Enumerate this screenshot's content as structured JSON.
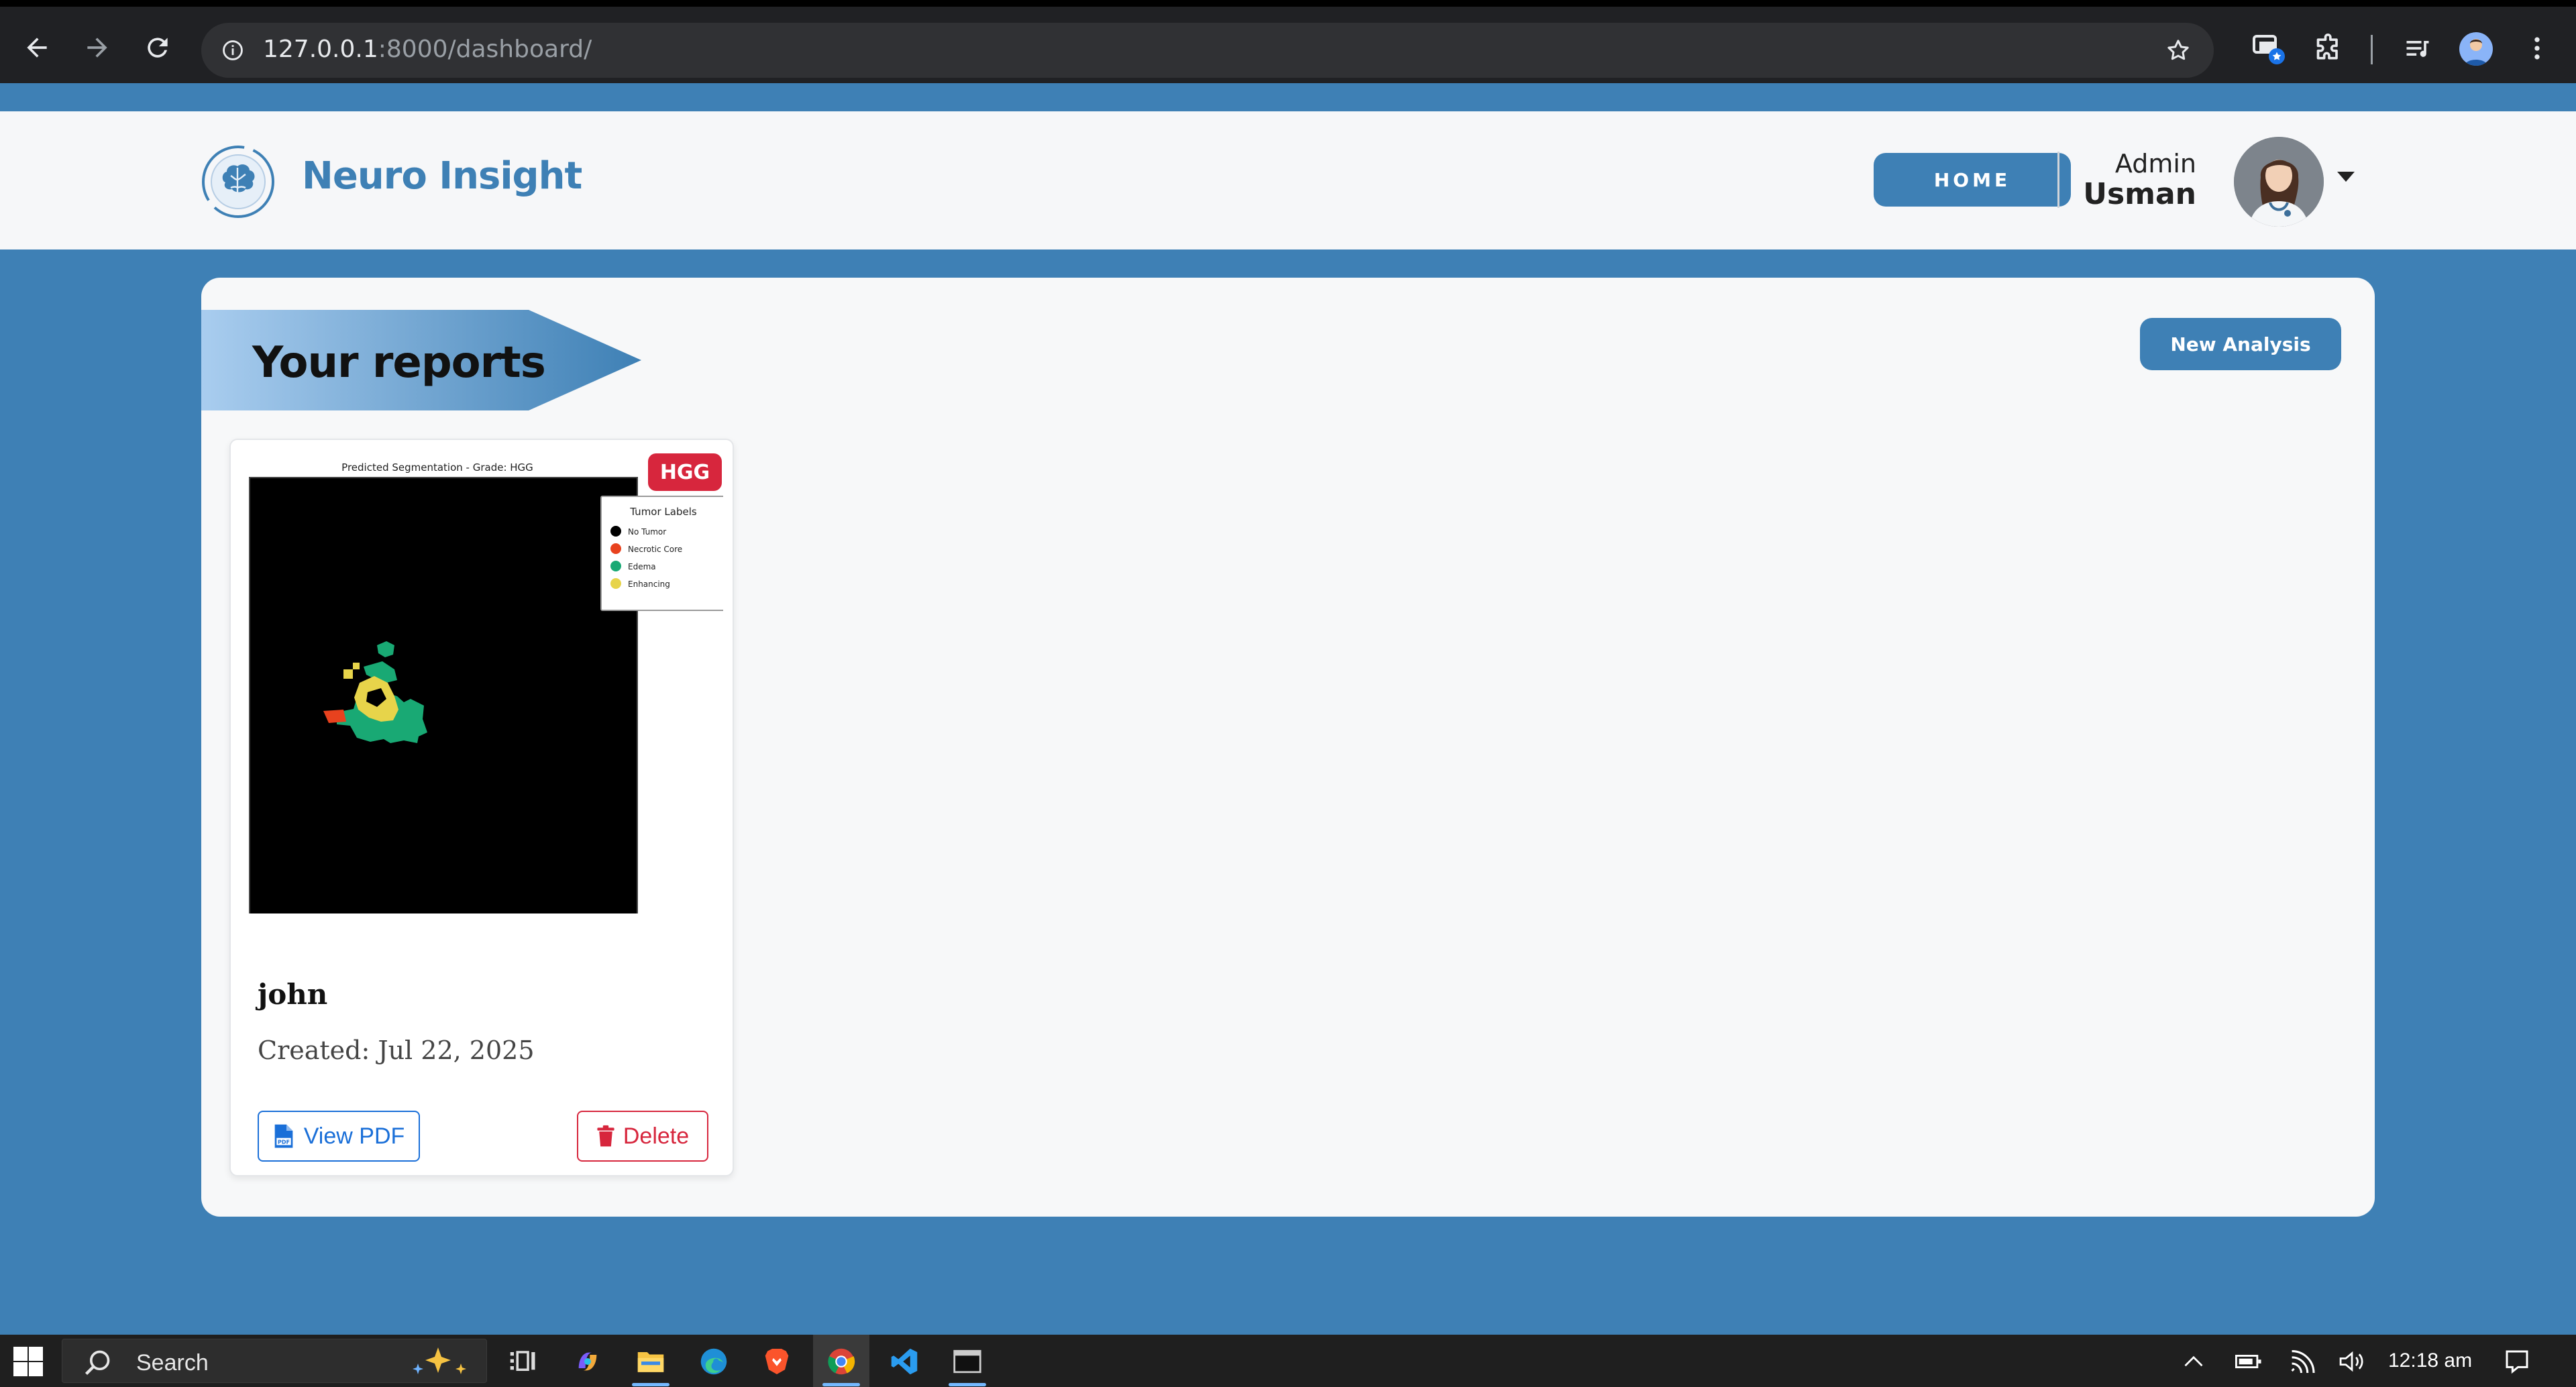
{
  "browser": {
    "url_host": "127.0.0.1",
    "url_path": ":8000/dashboard/"
  },
  "header": {
    "brand": "Neuro Insight",
    "home_label": "HOME",
    "user_role": "Admin",
    "user_name": "Usman"
  },
  "main": {
    "title": "Your reports",
    "new_analysis_label": "New Analysis",
    "reports": [
      {
        "grade_badge": "HGG",
        "figure_title": "Predicted Segmentation - Grade: HGG",
        "legend_title": "Tumor Labels",
        "legend": [
          {
            "label": "No Tumor",
            "color": "#000000"
          },
          {
            "label": "Necrotic Core",
            "color": "#e8421e"
          },
          {
            "label": "Edema",
            "color": "#19a974"
          },
          {
            "label": "Enhancing",
            "color": "#e7d44a"
          }
        ],
        "name": "john",
        "created": "Created: Jul 22, 2025",
        "view_pdf_label": "View PDF",
        "delete_label": "Delete"
      }
    ]
  },
  "taskbar": {
    "search_label": "Search",
    "clock": "12:18 am"
  },
  "colors": {
    "brand_blue": "#3e80b5",
    "danger": "#d7263d",
    "link_blue": "#1a6fd8"
  }
}
